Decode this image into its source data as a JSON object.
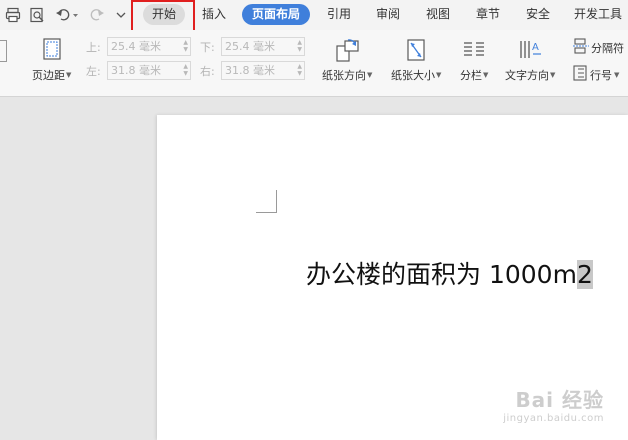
{
  "menu": {
    "tabs": [
      {
        "label": "开始"
      },
      {
        "label": "插入"
      },
      {
        "label": "页面布局"
      },
      {
        "label": "引用"
      },
      {
        "label": "审阅"
      },
      {
        "label": "视图"
      },
      {
        "label": "章节"
      },
      {
        "label": "安全"
      },
      {
        "label": "开发工具"
      }
    ],
    "active_tab": "页面布局",
    "highlighted_tab": "开始",
    "accent_color": "#3f7fdb",
    "highlight_color": "#e01f1f"
  },
  "quick_access": [
    {
      "icon": "print-icon"
    },
    {
      "icon": "print-preview-icon"
    },
    {
      "icon": "undo-icon"
    },
    {
      "icon": "redo-icon"
    },
    {
      "icon": "customize-dropdown-icon"
    }
  ],
  "ribbon": {
    "margins_button": {
      "label": "页边距",
      "icon": "page-margins-icon"
    },
    "margin_top": {
      "label": "上:",
      "value": "25.4 毫米"
    },
    "margin_bottom": {
      "label": "下:",
      "value": "25.4 毫米"
    },
    "margin_left": {
      "label": "左:",
      "value": "31.8 毫米"
    },
    "margin_right": {
      "label": "右:",
      "value": "31.8 毫米"
    },
    "orientation": {
      "label": "纸张方向",
      "icon": "paper-orientation-icon"
    },
    "size": {
      "label": "纸张大小",
      "icon": "paper-size-icon"
    },
    "columns": {
      "label": "分栏",
      "icon": "columns-icon"
    },
    "text_direction": {
      "label": "文字方向",
      "icon": "text-direction-icon"
    },
    "separator": {
      "label": "分隔符",
      "icon": "separator-icon"
    },
    "line_numbers": {
      "label": "行号",
      "icon": "line-numbers-icon"
    }
  },
  "document": {
    "text": "办公楼的面积为 1000m",
    "selected_text": "2"
  },
  "watermark": {
    "top": "Bai 经验",
    "bottom": "jingyan.baidu.com"
  }
}
